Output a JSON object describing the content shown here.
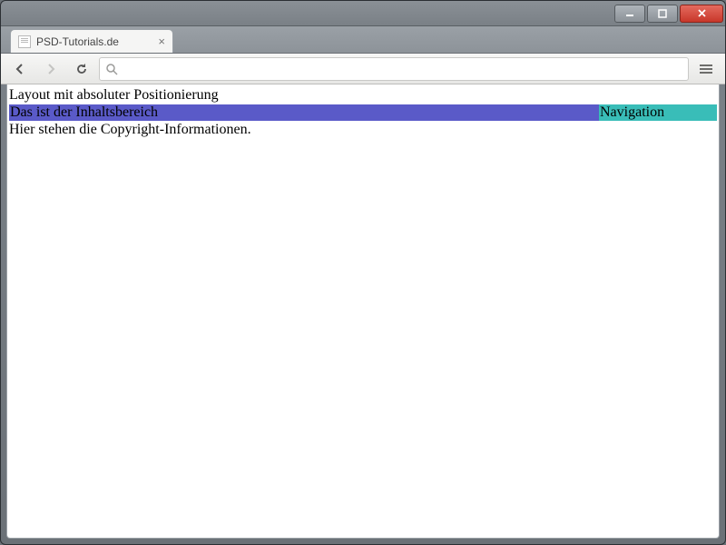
{
  "window": {
    "tab_title": "PSD-Tutorials.de"
  },
  "page": {
    "header": "Layout mit absoluter Positionierung",
    "content": "Das ist der Inhaltsbereich",
    "navigation": "Navigation",
    "footer": "Hier stehen die Copyright-Informationen."
  },
  "colors": {
    "content_bg": "#5a5ac8",
    "nav_bg": "#39bdb8"
  }
}
